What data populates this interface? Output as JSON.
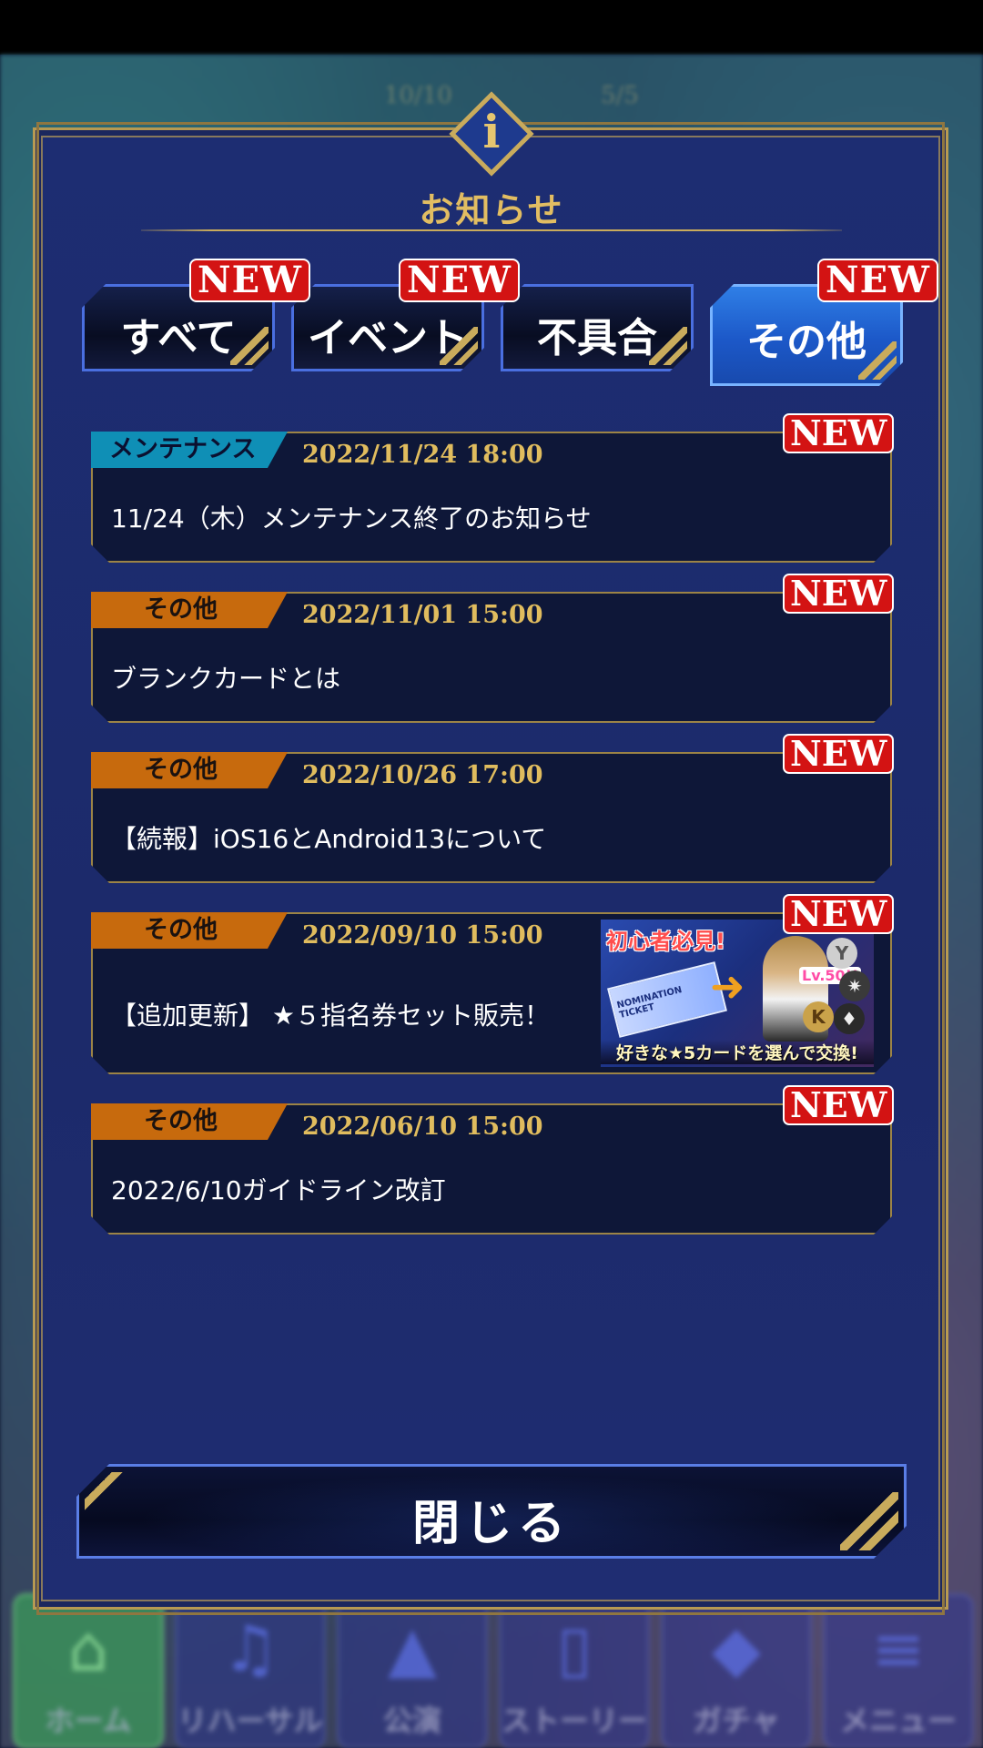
{
  "hud": {
    "stamina": "10/10",
    "tickets": "5/5"
  },
  "dialog": {
    "icon": "info-icon",
    "icon_letter": "i",
    "title": "お知らせ"
  },
  "tabs": [
    {
      "label": "すべて",
      "new": "NEW",
      "active": false
    },
    {
      "label": "イベント",
      "new": "NEW",
      "active": false
    },
    {
      "label": "不具合",
      "new": "",
      "active": false
    },
    {
      "label": "その他",
      "new": "NEW",
      "active": true
    }
  ],
  "notices": [
    {
      "category": "メンテナンス",
      "date": "2022/11/24 18:00",
      "title": "11/24（木）メンテナンス終了のお知らせ",
      "new": "NEW"
    },
    {
      "category": "その他",
      "date": "2022/11/01 15:00",
      "title": "ブランクカードとは",
      "new": "NEW"
    },
    {
      "category": "その他",
      "date": "2022/10/26 17:00",
      "title": "【続報】iOS16とAndroid13について",
      "new": "NEW"
    },
    {
      "category": "その他",
      "date": "2022/09/10 15:00",
      "title": "【追加更新】 ★５指名券セット販売！",
      "new": "NEW",
      "banner": {
        "top_text": "初心者必見!",
        "ticket_text": "NOMINATION TICKET",
        "level_text": "Lv.50!!",
        "bottom_text": "好きな★5カードを選んで交換!"
      }
    },
    {
      "category": "その他",
      "date": "2022/06/10 15:00",
      "title": "2022/6/10ガイドライン改訂",
      "new": "NEW"
    }
  ],
  "close_button": "閉じる",
  "bottom_nav": [
    {
      "label": "ホーム",
      "icon": "home-icon",
      "active": true
    },
    {
      "label": "リハーサル",
      "icon": "rehearsal-icon",
      "active": false
    },
    {
      "label": "公演",
      "icon": "stage-icon",
      "active": false
    },
    {
      "label": "ストーリー",
      "icon": "book-icon",
      "active": false
    },
    {
      "label": "ガチャ",
      "icon": "gem-icon",
      "active": false
    },
    {
      "label": "メニュー",
      "icon": "menu-icon",
      "active": false
    }
  ],
  "colors": {
    "panel": "#1d2d72",
    "gold": "#e0bc5e",
    "new_badge": "#d31313",
    "maintenance_tag": "#0f8fb6",
    "other_tag": "#c76a0d",
    "active_tab": "#2f7fe6"
  }
}
